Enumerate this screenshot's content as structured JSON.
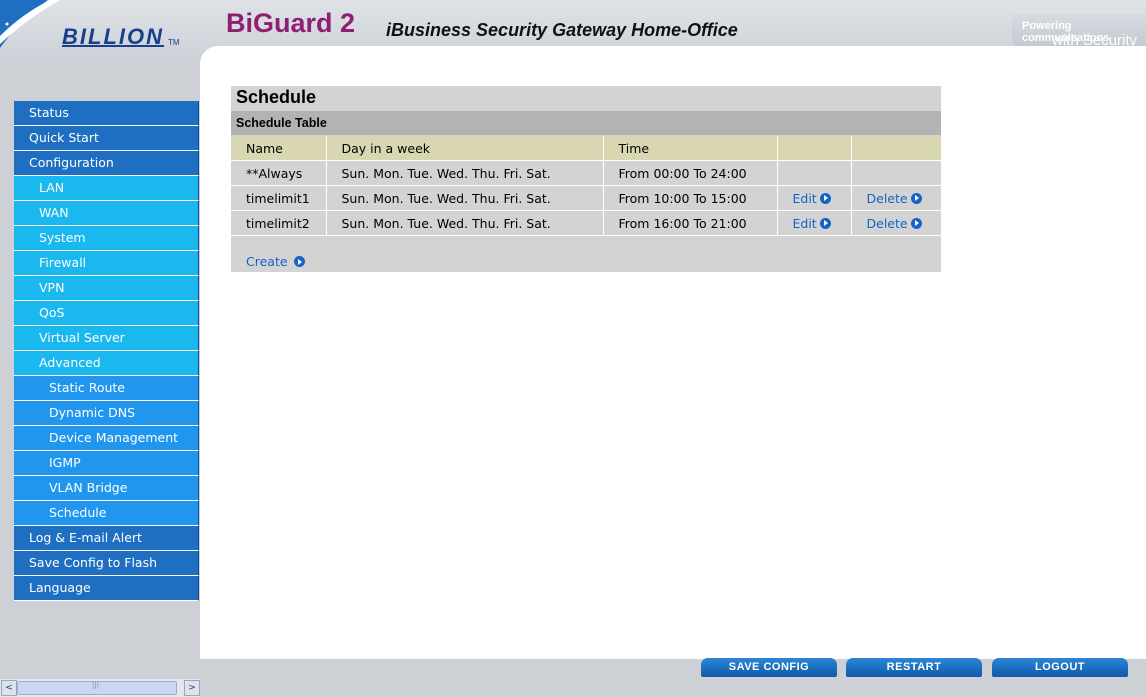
{
  "header": {
    "brand": "BILLION",
    "brand_tm": "TM",
    "product_logo": "BiGuard 2",
    "product_title": "iBusiness Security Gateway Home-Office",
    "slogan_line1": "Powering communications",
    "slogan_line2": "with Security"
  },
  "sidebar": {
    "items": [
      {
        "label": "Status"
      },
      {
        "label": "Quick Start"
      },
      {
        "label": "Configuration"
      },
      {
        "label": "LAN"
      },
      {
        "label": "WAN"
      },
      {
        "label": "System"
      },
      {
        "label": "Firewall"
      },
      {
        "label": "VPN"
      },
      {
        "label": "QoS"
      },
      {
        "label": "Virtual Server"
      },
      {
        "label": "Advanced"
      },
      {
        "label": "Static Route"
      },
      {
        "label": "Dynamic DNS"
      },
      {
        "label": "Device Management"
      },
      {
        "label": "IGMP"
      },
      {
        "label": "VLAN Bridge"
      },
      {
        "label": "Schedule"
      },
      {
        "label": "Log & E-mail Alert"
      },
      {
        "label": "Save Config to Flash"
      },
      {
        "label": "Language"
      }
    ]
  },
  "schedule": {
    "title": "Schedule",
    "table_title": "Schedule Table",
    "columns": [
      "Name",
      "Day in a week",
      "Time"
    ],
    "rows": [
      {
        "name": "**Always",
        "days": "Sun. Mon. Tue. Wed. Thu. Fri. Sat.",
        "time": "From 00:00 To 24:00",
        "edit": "",
        "delete": ""
      },
      {
        "name": "timelimit1",
        "days": "Sun. Mon. Tue. Wed. Thu. Fri. Sat.",
        "time": "From 10:00 To 15:00",
        "edit": "Edit",
        "delete": "Delete"
      },
      {
        "name": "timelimit2",
        "days": "Sun. Mon. Tue. Wed. Thu. Fri. Sat.",
        "time": "From 16:00 To 21:00",
        "edit": "Edit",
        "delete": "Delete"
      }
    ],
    "create_label": "Create"
  },
  "footer": {
    "save_config": "SAVE CONFIG",
    "restart": "RESTART",
    "logout": "LOGOUT"
  },
  "scrollbar": {
    "left_arrow": "<",
    "right_arrow": ">",
    "thumb_grip": "|||"
  },
  "colors": {
    "nav_top": "#1e6fc2",
    "nav_sub": "#19b8ee",
    "nav_sub2": "#2196ee",
    "link": "#1464c8",
    "table_header": "#d8d7b1",
    "brand_purple": "#8e1f73"
  }
}
